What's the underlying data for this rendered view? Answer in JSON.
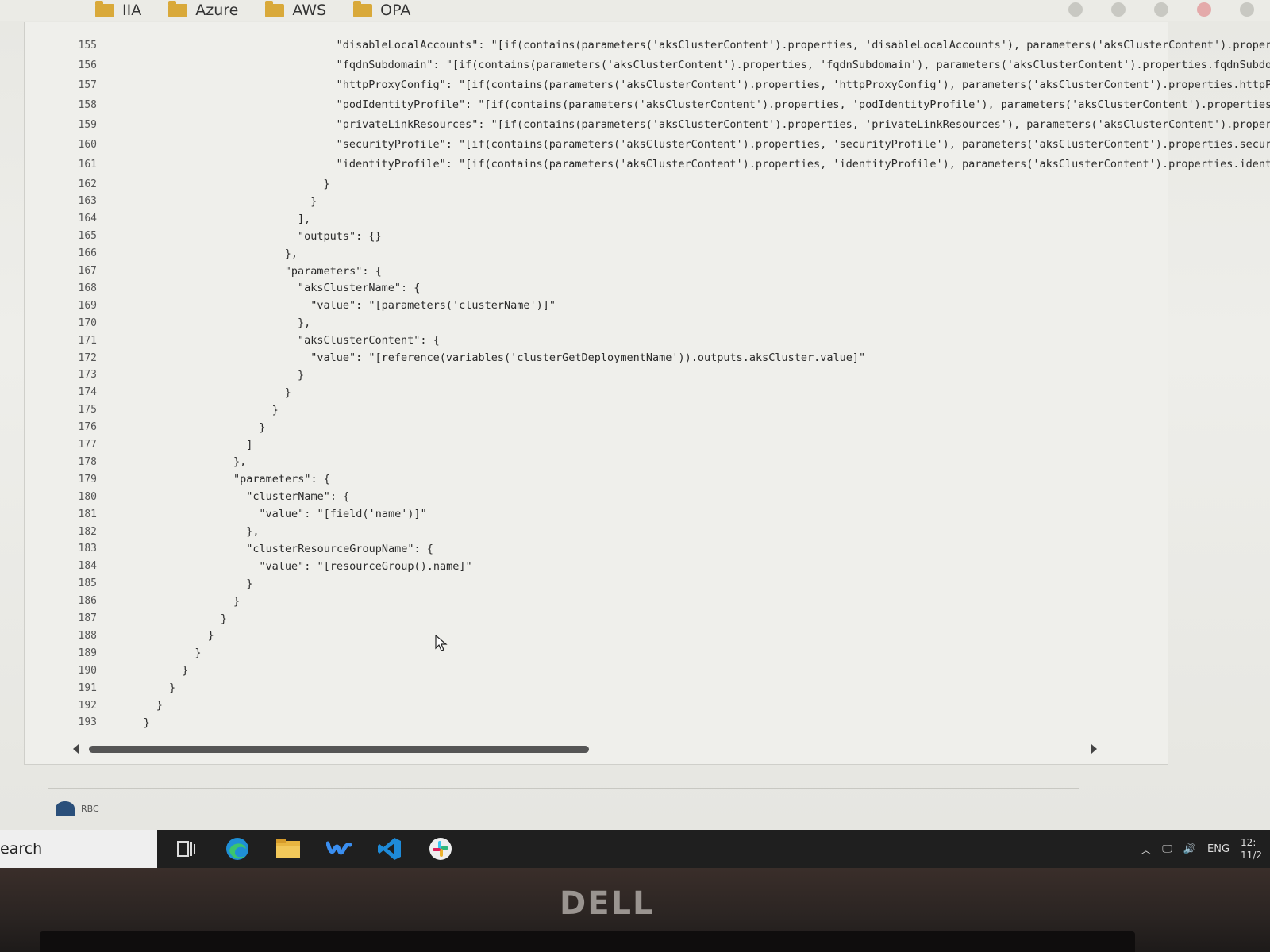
{
  "bookmarks": [
    "IIA",
    "Azure",
    "AWS",
    "OPA"
  ],
  "code_lines": [
    {
      "n": "155",
      "indent": 36,
      "text": "\"disableLocalAccounts\": \"[if(contains(parameters('aksClusterContent').properties, 'disableLocalAccounts'), parameters('aksClusterContent').proper"
    },
    {
      "n": "156",
      "indent": 36,
      "text": "\"fqdnSubdomain\": \"[if(contains(parameters('aksClusterContent').properties, 'fqdnSubdomain'), parameters('aksClusterContent').properties.fqdnSubdo"
    },
    {
      "n": "157",
      "indent": 36,
      "text": "\"httpProxyConfig\": \"[if(contains(parameters('aksClusterContent').properties, 'httpProxyConfig'), parameters('aksClusterContent').properties.httpP"
    },
    {
      "n": "158",
      "indent": 36,
      "text": "\"podIdentityProfile\": \"[if(contains(parameters('aksClusterContent').properties, 'podIdentityProfile'), parameters('aksClusterContent').properties"
    },
    {
      "n": "159",
      "indent": 36,
      "text": "\"privateLinkResources\": \"[if(contains(parameters('aksClusterContent').properties, 'privateLinkResources'), parameters('aksClusterContent').proper"
    },
    {
      "n": "160",
      "indent": 36,
      "text": "\"securityProfile\": \"[if(contains(parameters('aksClusterContent').properties, 'securityProfile'), parameters('aksClusterContent').properties.secur"
    },
    {
      "n": "161",
      "indent": 36,
      "text": "\"identityProfile\": \"[if(contains(parameters('aksClusterContent').properties, 'identityProfile'), parameters('aksClusterContent').properties.ident"
    },
    {
      "n": "162",
      "indent": 34,
      "text": "}"
    },
    {
      "n": "163",
      "indent": 32,
      "text": "}"
    },
    {
      "n": "164",
      "indent": 30,
      "text": "],"
    },
    {
      "n": "165",
      "indent": 30,
      "text": "\"outputs\": {}"
    },
    {
      "n": "166",
      "indent": 28,
      "text": "},"
    },
    {
      "n": "167",
      "indent": 28,
      "text": "\"parameters\": {"
    },
    {
      "n": "168",
      "indent": 30,
      "text": "\"aksClusterName\": {"
    },
    {
      "n": "169",
      "indent": 32,
      "text": "\"value\": \"[parameters('clusterName')]\""
    },
    {
      "n": "170",
      "indent": 30,
      "text": "},"
    },
    {
      "n": "171",
      "indent": 30,
      "text": "\"aksClusterContent\": {"
    },
    {
      "n": "172",
      "indent": 32,
      "text": "\"value\": \"[reference(variables('clusterGetDeploymentName')).outputs.aksCluster.value]\""
    },
    {
      "n": "173",
      "indent": 30,
      "text": "}"
    },
    {
      "n": "174",
      "indent": 28,
      "text": "}"
    },
    {
      "n": "175",
      "indent": 26,
      "text": "}"
    },
    {
      "n": "176",
      "indent": 24,
      "text": "}"
    },
    {
      "n": "177",
      "indent": 22,
      "text": "]"
    },
    {
      "n": "178",
      "indent": 20,
      "text": "},"
    },
    {
      "n": "179",
      "indent": 20,
      "text": "\"parameters\": {"
    },
    {
      "n": "180",
      "indent": 22,
      "text": "\"clusterName\": {"
    },
    {
      "n": "181",
      "indent": 24,
      "text": "\"value\": \"[field('name')]\""
    },
    {
      "n": "182",
      "indent": 22,
      "text": "},"
    },
    {
      "n": "183",
      "indent": 22,
      "text": "\"clusterResourceGroupName\": {"
    },
    {
      "n": "184",
      "indent": 24,
      "text": "\"value\": \"[resourceGroup().name]\""
    },
    {
      "n": "185",
      "indent": 22,
      "text": "}"
    },
    {
      "n": "186",
      "indent": 20,
      "text": "}"
    },
    {
      "n": "187",
      "indent": 18,
      "text": "}"
    },
    {
      "n": "188",
      "indent": 16,
      "text": "}"
    },
    {
      "n": "189",
      "indent": 14,
      "text": "}"
    },
    {
      "n": "190",
      "indent": 12,
      "text": "}"
    },
    {
      "n": "191",
      "indent": 10,
      "text": "}"
    },
    {
      "n": "192",
      "indent": 8,
      "text": "}"
    },
    {
      "n": "193",
      "indent": 6,
      "text": "}"
    }
  ],
  "footer_label": "RBC",
  "taskbar": {
    "search_text": "earch",
    "icons": [
      "task-view-icon",
      "edge-icon",
      "file-explorer-icon",
      "webex-icon",
      "vscode-icon",
      "slack-icon"
    ],
    "tray_lang": "ENG",
    "tray_time": "12:",
    "tray_date": "11/2"
  },
  "bezel_brand": "DELL"
}
